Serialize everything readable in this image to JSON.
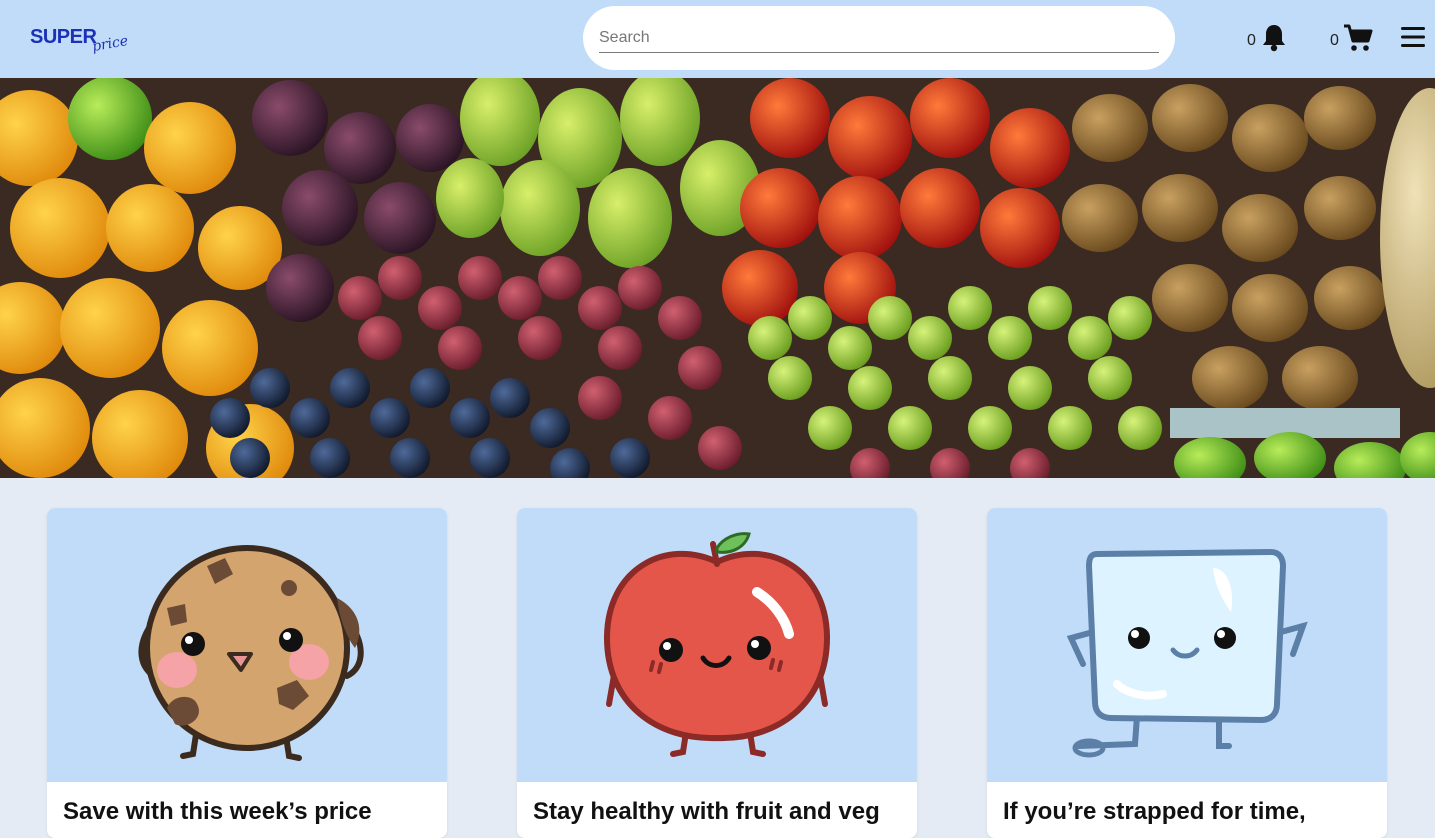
{
  "header": {
    "logo_main": "SUPER",
    "logo_script": "price",
    "search": {
      "placeholder": "Search",
      "value": ""
    },
    "notifications": {
      "count": "0",
      "icon": "bell-icon"
    },
    "cart": {
      "count": "0",
      "icon": "cart-icon"
    },
    "menu_icon": "hamburger-menu-icon"
  },
  "hero": {
    "icon": "fruit-market-banner"
  },
  "cards": [
    {
      "title": "Save with this week’s price",
      "icon": "cookie-mascot-icon"
    },
    {
      "title": "Stay healthy with fruit and veg",
      "icon": "apple-mascot-icon"
    },
    {
      "title": "If you’re strapped for time,",
      "icon": "ice-cube-mascot-icon"
    }
  ],
  "colors": {
    "header_bg": "#c1dcf8",
    "page_bg": "#e4ebf4",
    "brand": "#1c31b8",
    "card_image_bg": "#c1dcf8"
  }
}
